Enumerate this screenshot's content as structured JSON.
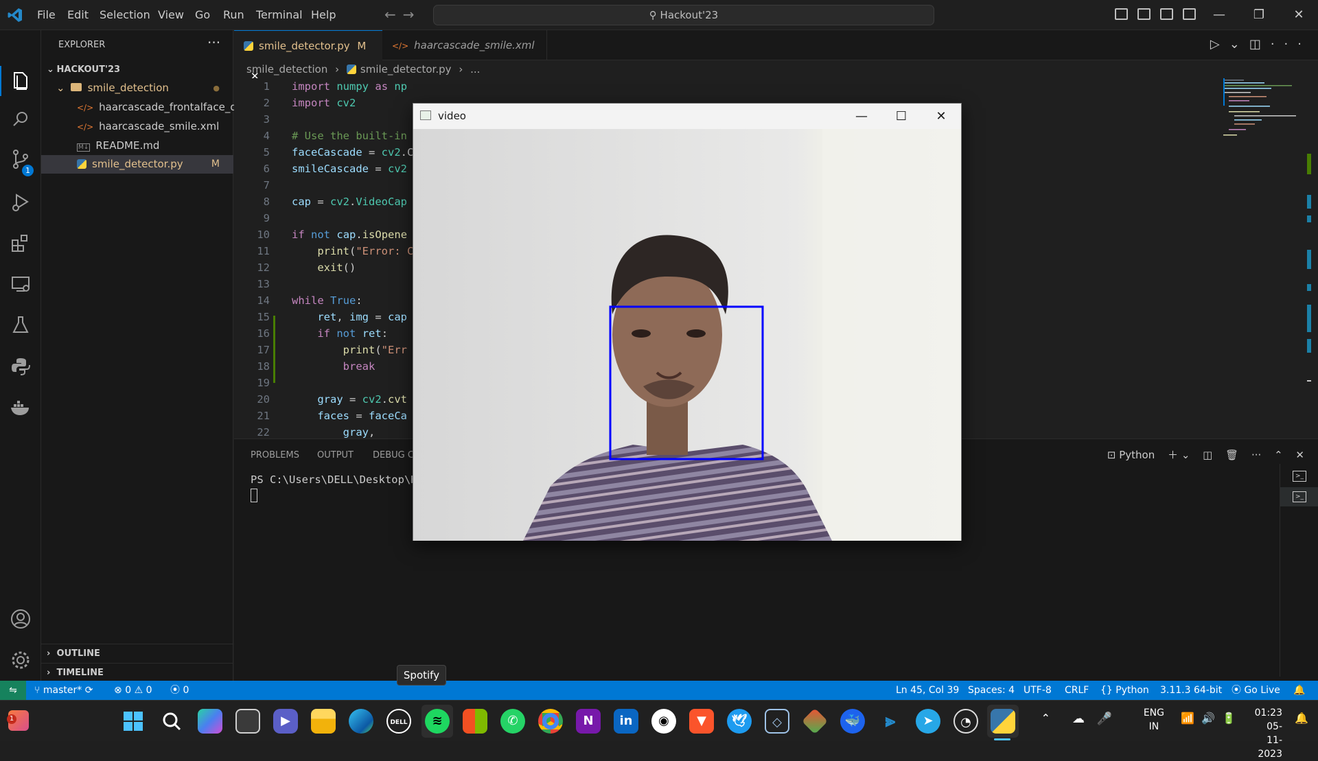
{
  "menu": [
    "File",
    "Edit",
    "Selection",
    "View",
    "Go",
    "Run",
    "Terminal",
    "Help"
  ],
  "command_center": "Hackout'23",
  "colors": {
    "accent": "#0078d4",
    "statusbar": "#0078d4",
    "modified": "#e2c08d",
    "face_box": "#0000ff"
  },
  "explorer": {
    "title": "EXPLORER",
    "root": "HACKOUT'23",
    "folder": "smile_detection",
    "files": [
      {
        "name": "haarcascade_frontalface_d...",
        "icon": "xml-icon",
        "badge": ""
      },
      {
        "name": "haarcascade_smile.xml",
        "icon": "xml-icon",
        "badge": ""
      },
      {
        "name": "README.md",
        "icon": "markdown-icon",
        "badge": ""
      },
      {
        "name": "smile_detector.py",
        "icon": "python-icon",
        "badge": "M"
      }
    ],
    "outline": "OUTLINE",
    "timeline": "TIMELINE",
    "source_control_badge": "1"
  },
  "tabs": [
    {
      "label": "smile_detector.py",
      "badge": "M"
    },
    {
      "label": "haarcascade_smile.xml"
    }
  ],
  "breadcrumb": [
    "smile_detection",
    "smile_detector.py",
    "..."
  ],
  "code": {
    "lines": [
      "1",
      "2",
      "3",
      "4",
      "5",
      "6",
      "7",
      "8",
      "9",
      "10",
      "11",
      "12",
      "13",
      "14",
      "15",
      "16",
      "17",
      "18",
      "19",
      "20",
      "21",
      "22"
    ]
  },
  "panel": {
    "tabs": [
      "PROBLEMS",
      "OUTPUT",
      "DEBUG C"
    ],
    "terminal_kind": "Python",
    "terminal_text": "PS C:\\Users\\DELL\\Desktop\\H"
  },
  "video_window": {
    "title": "video"
  },
  "status": {
    "branch": "master*",
    "errors": "0",
    "warnings": "0",
    "ports": "0",
    "position": "Ln 45, Col 39",
    "spaces": "Spaces: 4",
    "encoding": "UTF-8",
    "eol": "CRLF",
    "language": "Python",
    "interpreter": "3.11.3 64-bit",
    "golive": "Go Live"
  },
  "tooltip": "Spotify",
  "taskbar": {
    "notification_badge": "1",
    "apps": [
      "start-icon",
      "search-icon",
      "copilot-icon",
      "task-view-icon",
      "teams-icon",
      "file-explorer-icon",
      "edge-icon",
      "dell-icon",
      "spotify-icon",
      "store-icon",
      "whatsapp-icon",
      "chrome-icon",
      "onenote-icon",
      "linkedin-icon",
      "github-icon",
      "brave-icon",
      "twitter-icon",
      "virtualbox-icon",
      "git-icon",
      "docker-icon",
      "vscode-icon",
      "telegram-icon",
      "obs-icon",
      "python-icon"
    ],
    "language_top": "ENG",
    "language_bottom": "IN",
    "time": "01:23",
    "date": "05-11-2023"
  }
}
